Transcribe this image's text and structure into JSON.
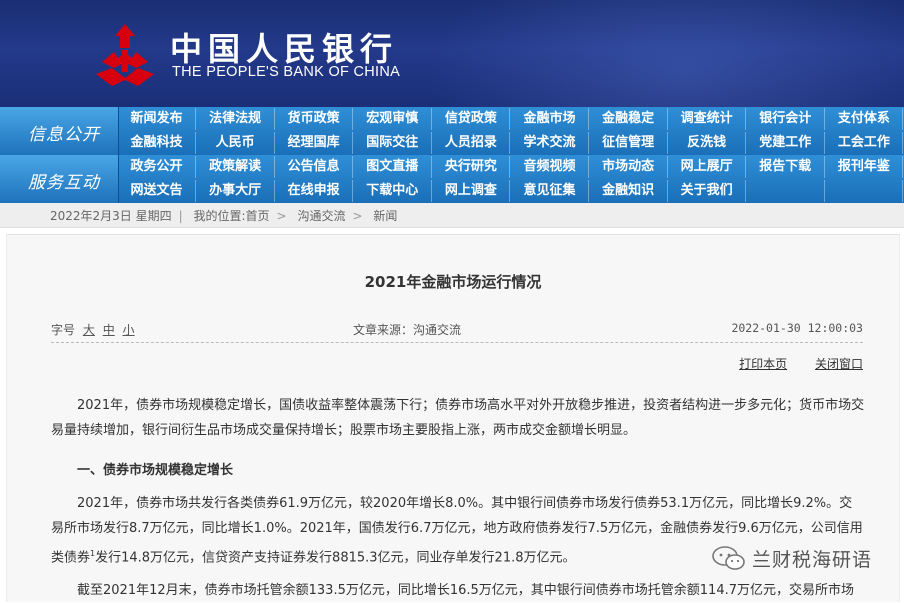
{
  "header": {
    "title_cn": "中国人民银行",
    "title_en": "THE PEOPLE'S BANK OF CHINA"
  },
  "nav": {
    "row1_label": "信息公开",
    "row2_label": "服务互动",
    "row1": [
      [
        "新闻发布",
        "法律法规",
        "货币政策",
        "宏观审慎",
        "信贷政策",
        "金融市场",
        "金融稳定",
        "调查统计",
        "银行会计",
        "支付体系"
      ],
      [
        "金融科技",
        "人民币",
        "经理国库",
        "国际交往",
        "人员招录",
        "学术交流",
        "征信管理",
        "反洗钱",
        "党建工作",
        "工会工作"
      ]
    ],
    "row2": [
      [
        "政务公开",
        "政策解读",
        "公告信息",
        "图文直播",
        "央行研究",
        "音频视频",
        "市场动态",
        "网上展厅",
        "报告下载",
        "报刊年鉴"
      ],
      [
        "网送文告",
        "办事大厅",
        "在线申报",
        "下载中心",
        "网上调查",
        "意见征集",
        "金融知识",
        "关于我们",
        "",
        ""
      ]
    ]
  },
  "breadcrumb": {
    "date": "2022年2月3日 星期四",
    "location": "我的位置:首页",
    "level1": "沟通交流",
    "level2": "新闻"
  },
  "article": {
    "title": "2021年金融市场运行情况",
    "font_size_label": "字号",
    "font_sizes": [
      "大",
      "中",
      "小"
    ],
    "source": "文章来源：沟通交流",
    "datetime": "2022-01-30 12:00:03",
    "print": "打印本页",
    "close": "关闭窗口",
    "p1": "2021年，债券市场规模稳定增长，国债收益率整体震荡下行；债券市场高水平对外开放稳步推进，投资者结构进一步多元化；货币市场交易量持续增加，银行间衍生品市场成交量保持增长；股票市场主要股指上涨，两市成交金额增长明显。",
    "section1": "一、债券市场规模稳定增长",
    "p2_a": "2021年，债券市场共发行各类债券61.9万亿元，较2020年增长8.0%。其中银行间债券市场发行债券53.1万亿元，同比增长9.2%。交易所市场发行8.7万亿元，同比增长1.0%。2021年，国债发行6.7万亿元，地方政府债券发行7.5万亿元，金融债券发行9.6万亿元，公司信用类债券",
    "p2_sup": "1",
    "p2_b": "发行14.8万亿元，信贷资产支持证券发行8815.3亿元，同业存单发行21.8万亿元。",
    "p3": "截至2021年12月末，债券市场托管余额133.5万亿元，同比增长16.5万亿元，其中银行间债券市场托管余额114.7万亿元，交易所市场"
  },
  "watermark": "兰财税海研语",
  "colors": {
    "header_bg": "#1d3178",
    "nav_bg": "#1f78c1",
    "logo_red": "#d7000f"
  }
}
